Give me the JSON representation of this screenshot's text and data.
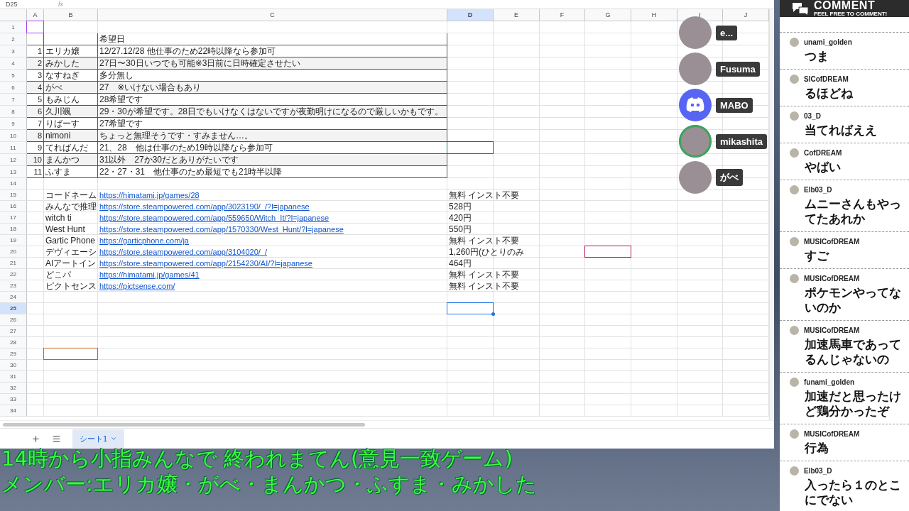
{
  "toolbar": {
    "name_box": "D25",
    "formula_label": "fx"
  },
  "columns": [
    {
      "label": "A",
      "selected": false
    },
    {
      "label": "B",
      "selected": false
    },
    {
      "label": "C",
      "selected": false
    },
    {
      "label": "D",
      "selected": true
    },
    {
      "label": "E",
      "selected": false
    },
    {
      "label": "F",
      "selected": false
    },
    {
      "label": "G",
      "selected": false
    },
    {
      "label": "H",
      "selected": false
    },
    {
      "label": "I",
      "selected": false
    },
    {
      "label": "J",
      "selected": false
    }
  ],
  "rows": [
    {
      "number": "1",
      "kind": "blank",
      "selected": false,
      "cursors": {
        "a": {
          "kind": "cursor",
          "color": "#a142f4"
        }
      }
    },
    {
      "number": "2",
      "kind": "table",
      "selected": false,
      "shaded": false,
      "c": "希望日"
    },
    {
      "number": "3",
      "kind": "table",
      "selected": false,
      "shaded": false,
      "a": "1",
      "b": "エリカ嬢",
      "c": "12/27.12/28 他仕事のため22時以降なら参加可"
    },
    {
      "number": "4",
      "kind": "table",
      "selected": false,
      "shaded": true,
      "a": "2",
      "b": "みかした",
      "c": "27日〜30日いつでも可能※3日前に日時確定させたい"
    },
    {
      "number": "5",
      "kind": "table",
      "selected": false,
      "shaded": false,
      "a": "3",
      "b": "なすねぎ",
      "c": "多分無し"
    },
    {
      "number": "6",
      "kind": "table",
      "selected": false,
      "shaded": true,
      "a": "4",
      "b": "がべ",
      "c": "27　※いけない場合もあり"
    },
    {
      "number": "7",
      "kind": "table",
      "selected": false,
      "shaded": false,
      "a": "5",
      "b": "もみじん",
      "c": "28希望です"
    },
    {
      "number": "8",
      "kind": "table",
      "selected": false,
      "shaded": true,
      "a": "6",
      "b": "久川颯",
      "c": "29・30が希望です。28日でもいけなくはないですが夜勤明けになるので厳しいかもです。"
    },
    {
      "number": "9",
      "kind": "table",
      "selected": false,
      "shaded": false,
      "a": "7",
      "b": "りばーす",
      "c": "27希望です"
    },
    {
      "number": "10",
      "kind": "table",
      "selected": false,
      "shaded": true,
      "a": "8",
      "b": "nimoni",
      "c": "ちょっと無理そうです・すみません…。"
    },
    {
      "number": "11",
      "kind": "table",
      "selected": false,
      "shaded": false,
      "a": "9",
      "b": "てればんだ",
      "c": "21、28　他は仕事のため19時以降なら参加可",
      "cursors": {
        "d": {
          "kind": "cursor",
          "color": "#137363"
        }
      }
    },
    {
      "number": "12",
      "kind": "table",
      "selected": false,
      "shaded": true,
      "a": "10",
      "b": "まんかつ",
      "c": "31以外　27か30だとありがたいです"
    },
    {
      "number": "13",
      "kind": "table",
      "selected": false,
      "shaded": false,
      "a": "11",
      "b": "ふすま",
      "c": "22・27・31　他仕事のため最短でも21時半以降"
    },
    {
      "number": "14",
      "kind": "blank",
      "selected": false
    },
    {
      "number": "15",
      "kind": "game",
      "selected": false,
      "b": "コードネーム",
      "c": "https://himatami.jp/games/28",
      "d": "無料 インスト不要"
    },
    {
      "number": "16",
      "kind": "game",
      "selected": false,
      "b": "みんなで推理",
      "c": "https://store.steampowered.com/app/3023190/_/?l=japanese",
      "d": "528円"
    },
    {
      "number": "17",
      "kind": "game",
      "selected": false,
      "b": "witch ti",
      "c": "https://store.steampowered.com/app/559650/Witch_It/?l=japanese",
      "d": "420円"
    },
    {
      "number": "18",
      "kind": "game",
      "selected": false,
      "b": "West Hunt",
      "c": "https://store.steampowered.com/app/1570330/West_Hunt/?l=japanese",
      "d": "550円"
    },
    {
      "number": "19",
      "kind": "game",
      "selected": false,
      "b": "Gartic Phone",
      "c": "https://garticphone.com/ja",
      "d": "無料 インスト不要"
    },
    {
      "number": "20",
      "kind": "game",
      "selected": false,
      "b": "デヴィエーシ",
      "c": "https://store.steampowered.com/app/3104020/_/",
      "d": " 1,260円(ひとりのみ",
      "cursors": {
        "g": {
          "kind": "cursor",
          "color": "#b0125b"
        }
      }
    },
    {
      "number": "21",
      "kind": "game",
      "selected": false,
      "b": "AIアートイン",
      "c": "https://store.steampowered.com/app/2154230/AI/?l=japanese",
      "d": "464円"
    },
    {
      "number": "22",
      "kind": "game",
      "selected": false,
      "b": "どこパ",
      "c": "https://himatami.jp/games/41",
      "d": "無料 インスト不要"
    },
    {
      "number": "23",
      "kind": "game",
      "selected": false,
      "b": "ピクトセンス",
      "c": "https://pictsense.com/",
      "d": "無料 インスト不要"
    },
    {
      "number": "24",
      "kind": "blank",
      "selected": false
    },
    {
      "number": "25",
      "kind": "blank",
      "selected": true,
      "cursors": {
        "d": {
          "kind": "selection",
          "color": "#1a73e8"
        }
      }
    },
    {
      "number": "26",
      "kind": "blank",
      "selected": false
    },
    {
      "number": "27",
      "kind": "blank",
      "selected": false
    },
    {
      "number": "28",
      "kind": "blank",
      "selected": false
    },
    {
      "number": "29",
      "kind": "blank",
      "selected": false,
      "cursors": {
        "b": {
          "kind": "cursor",
          "color": "#c5611a"
        }
      }
    },
    {
      "number": "30",
      "kind": "blank",
      "selected": false
    },
    {
      "number": "31",
      "kind": "blank",
      "selected": false
    },
    {
      "number": "32",
      "kind": "blank",
      "selected": false
    },
    {
      "number": "33",
      "kind": "blank",
      "selected": false
    },
    {
      "number": "34",
      "kind": "blank",
      "selected": false
    }
  ],
  "sheet_tabs": [
    {
      "label": "シート1",
      "selected": true
    }
  ],
  "overlay_lines": [
    "14時から小指みんなで 終われまてん(意見一致ゲーム)",
    "メンバー:エリカ嬢・がべ・まんかつ・ふすま・みかした"
  ],
  "chat": {
    "title": "COMMENT",
    "subtitle": "FEEL FREE TO COMMENT!",
    "messages": [
      {
        "user": "unami_golden",
        "text": "つま"
      },
      {
        "user": "SICofDREAM",
        "text": "るほどね"
      },
      {
        "user": "03_D",
        "text": "当てればええ"
      },
      {
        "user": "CofDREAM",
        "text": "やばい"
      },
      {
        "user": "Elb03_D",
        "text": "ムニーさんもやってたあれか"
      },
      {
        "user": "MUSICofDREAM",
        "text": "すご"
      },
      {
        "user": "MUSICofDREAM",
        "text": "ポケモンやってないのか"
      },
      {
        "user": "MUSICofDREAM",
        "text": "加速馬車であってるんじゃないの"
      },
      {
        "user": "funami_golden",
        "text": "加速だと思ったけど鶏分かったぞ"
      },
      {
        "user": "MUSICofDREAM",
        "text": "行為"
      },
      {
        "user": "Elb03_D",
        "text": "入ったら１のとこにでない"
      }
    ]
  },
  "voice_overlay": [
    {
      "name": "e...",
      "kind": "photo",
      "speaking": false
    },
    {
      "name": "Fusuma",
      "kind": "photo",
      "speaking": false
    },
    {
      "name": "MABO",
      "kind": "logo",
      "speaking": false
    },
    {
      "name": "mikashita",
      "kind": "photo",
      "speaking": true
    },
    {
      "name": "がべ",
      "kind": "photo",
      "speaking": false
    }
  ]
}
